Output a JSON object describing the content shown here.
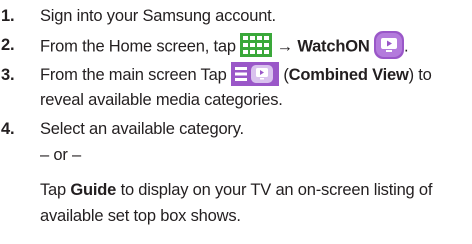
{
  "steps": [
    {
      "number": "1.",
      "text": "Sign into your Samsung account."
    },
    {
      "number": "2.",
      "text_before": "From the Home screen, tap",
      "apps_icon": "apps-grid-icon",
      "arrow": "→",
      "bold": "WatchON",
      "watchon_icon": "watchon-app-icon",
      "text_after": "."
    },
    {
      "number": "3.",
      "text_before": "From the main screen Tap",
      "combined_icon": "combined-view-icon",
      "paren_open": "(",
      "bold": "Combined View",
      "paren_close": ") to",
      "line2": "reveal available media categories."
    },
    {
      "number": "4.",
      "text": "Select an available category.",
      "or_text": "– or –",
      "guide_prefix": "Tap",
      "guide_bold": "Guide",
      "guide_suffix": "to display on your TV an on-screen listing of",
      "guide_line2": "available set top box shows."
    }
  ],
  "colors": {
    "text": "#231f20",
    "icon_green": "#3aa83a",
    "icon_purple": "#9a57c8",
    "icon_purple_light": "#d9c2ee"
  }
}
